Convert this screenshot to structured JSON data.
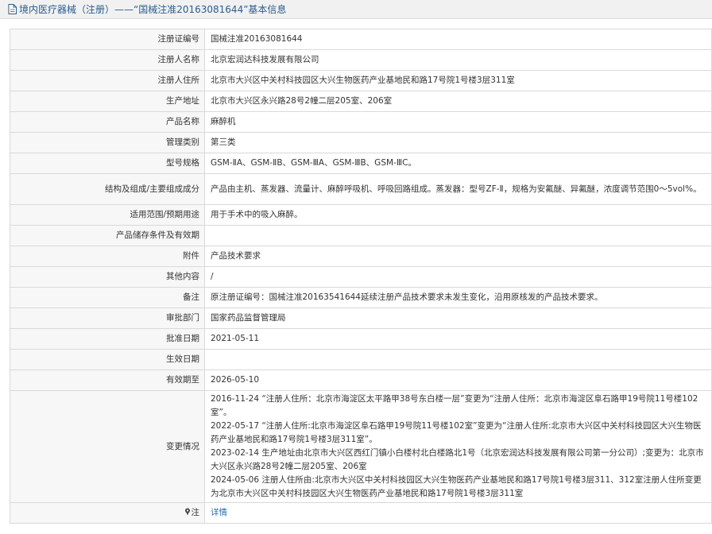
{
  "header": {
    "title": "境内医疗器械（注册）——“国械注准20163081644”基本信息"
  },
  "rows": [
    {
      "label": "注册证编号",
      "value": "国械注准20163081644"
    },
    {
      "label": "注册人名称",
      "value": "北京宏润达科技发展有限公司"
    },
    {
      "label": "注册人住所",
      "value": "北京市大兴区中关村科技园区大兴生物医药产业基地民和路17号院1号楼3层311室"
    },
    {
      "label": "生产地址",
      "value": "北京市大兴区永兴路28号2幢二层205室、206室"
    },
    {
      "label": "产品名称",
      "value": "麻醉机"
    },
    {
      "label": "管理类别",
      "value": "第三类"
    },
    {
      "label": "型号规格",
      "value": "GSM-ⅡA、GSM-ⅡB、GSM-ⅢA、GSM-ⅢB、GSM-ⅢC。"
    },
    {
      "label": "结构及组成/主要组成成分",
      "value": "产品由主机、蒸发器、流量计、麻醉呼吸机、呼吸回路组成。蒸发器：型号ZF-Ⅱ，规格为安氟醚、异氟醚，浓度调节范围0～5vol%。"
    },
    {
      "label": "适用范围/预期用途",
      "value": "用于手术中的吸入麻醉。"
    },
    {
      "label": "产品储存条件及有效期",
      "value": ""
    },
    {
      "label": "附件",
      "value": "产品技术要求"
    },
    {
      "label": "其他内容",
      "value": "/"
    },
    {
      "label": "备注",
      "value": "原注册证编号：国械注准20163541644延续注册产品技术要求未发生变化，沿用原核发的产品技术要求。"
    },
    {
      "label": "审批部门",
      "value": "国家药品监督管理局"
    },
    {
      "label": "批准日期",
      "value": "2021-05-11"
    },
    {
      "label": "生效日期",
      "value": ""
    },
    {
      "label": "有效期至",
      "value": "2026-05-10"
    }
  ],
  "changes": {
    "label": "变更情况",
    "items": [
      "2016-11-24 “注册人住所：北京市海淀区太平路甲38号东白楼一层”变更为“注册人住所：北京市海淀区阜石路甲19号院11号楼102室”。",
      "2022-05-17 “注册人住所:北京市海淀区阜石路甲19号院11号楼102室”变更为“注册人住所:北京市大兴区中关村科技园区大兴生物医药产业基地民和路17号院1号楼3层311室”。",
      "2023-02-14 生产地址由北京市大兴区西红门镇小白楼村北白楼路北1号（北京宏润达科技发展有限公司第一分公司）;变更为：北京市大兴区永兴路28号2幢二层205室、206室",
      "2024-05-06 注册人住所由:北京市大兴区中关村科技园区大兴生物医药产业基地民和路17号院1号楼3层311、312室注册人住所变更为北京市大兴区中关村科技园区大兴生物医药产业基地民和路17号院1号楼3层311室"
    ]
  },
  "note": {
    "label": "注",
    "link": "详情"
  }
}
